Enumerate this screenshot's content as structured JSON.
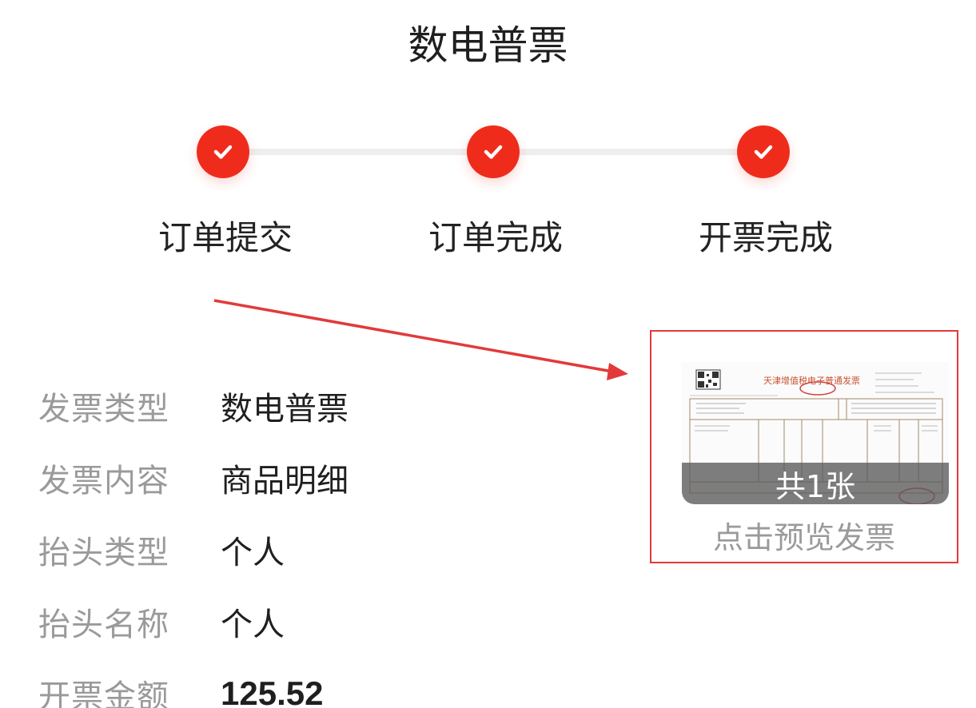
{
  "header": {
    "title": "数电普票"
  },
  "progress": {
    "steps": [
      {
        "label": "订单提交",
        "done": true
      },
      {
        "label": "订单完成",
        "done": true
      },
      {
        "label": "开票完成",
        "done": true
      }
    ],
    "accent_color": "#ef2c1c"
  },
  "details": {
    "rows": [
      {
        "label": "发票类型",
        "value": "数电普票"
      },
      {
        "label": "发票内容",
        "value": "商品明细"
      },
      {
        "label": "抬头类型",
        "value": "个人"
      },
      {
        "label": "抬头名称",
        "value": "个人"
      },
      {
        "label": "开票金额",
        "value": "125.52"
      }
    ]
  },
  "preview": {
    "invoice_heading": "天津增值税电子普通发票",
    "count_label": "共1张",
    "caption": "点击预览发票"
  },
  "icons": [
    "check-icon",
    "arrow-annotation"
  ]
}
